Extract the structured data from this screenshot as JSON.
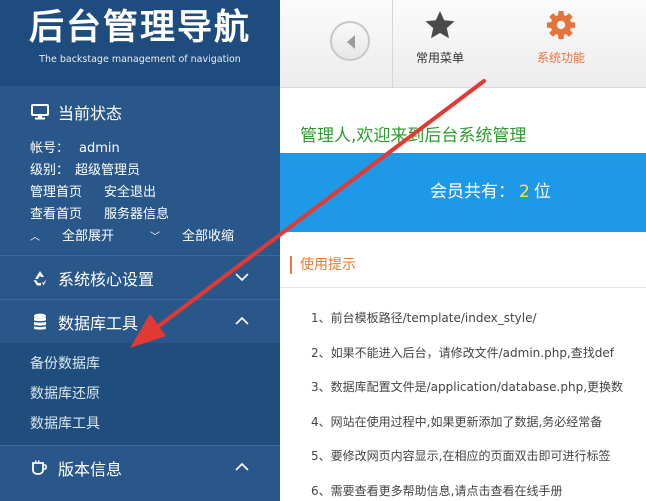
{
  "sidebar": {
    "logo_title": "后台管理导航",
    "logo_subtitle": "The backstage management of navigation",
    "current_status": {
      "title": "当前状态",
      "account_label": "帐号：",
      "account_value": "admin",
      "level_label": "级别：",
      "level_value": "超级管理员",
      "links_row1": [
        "管理首页",
        "安全退出"
      ],
      "links_row2": [
        "查看首页",
        "服务器信息"
      ],
      "expand_all": "全部展开",
      "collapse_all": "全部收缩"
    },
    "system_settings": {
      "title": "系统核心设置"
    },
    "database_tools": {
      "title": "数据库工具",
      "items": [
        "备份数据库",
        "数据库还原",
        "数据库工具"
      ]
    },
    "version_info": {
      "title": "版本信息"
    }
  },
  "header": {
    "common_menu_label": "常用菜单",
    "system_functions_label": "系统功能"
  },
  "main": {
    "welcome": "管理人,欢迎来到后台系统管理",
    "member_count_prefix": "会员共有：",
    "member_count": "2",
    "member_count_suffix": "位",
    "tips_title": "使用提示",
    "tips": [
      "1、前台模板路径/template/index_style/",
      "2、如果不能进入后台，请修改文件/admin.php,查找def",
      "3、数据库配置文件是/application/database.php,更换数",
      "4、网站在使用过程中,如果更新添加了数据,务必经常备",
      "5、要修改网页内容显示,在相应的页面双击即可进行标签",
      "6、需要查看更多帮助信息,请点击查看在线手册"
    ]
  },
  "colors": {
    "sidebar_bg": "#2a5789",
    "logo_bg": "#1e4c7e",
    "accent_orange": "#e5743b",
    "member_bar_bg": "#1e99e8",
    "welcome_green": "#2e9b2e",
    "count_yellow": "#ffe04a",
    "annotation_red": "#e23a33"
  },
  "icons": {
    "status": "monitor-icon",
    "system_settings": "recycle-icon",
    "database_tools": "database-icon",
    "version_info": "coffee-cup-icon",
    "common_menu": "star-icon",
    "system_functions": "gear-icon",
    "back": "back-arrow-icon"
  }
}
